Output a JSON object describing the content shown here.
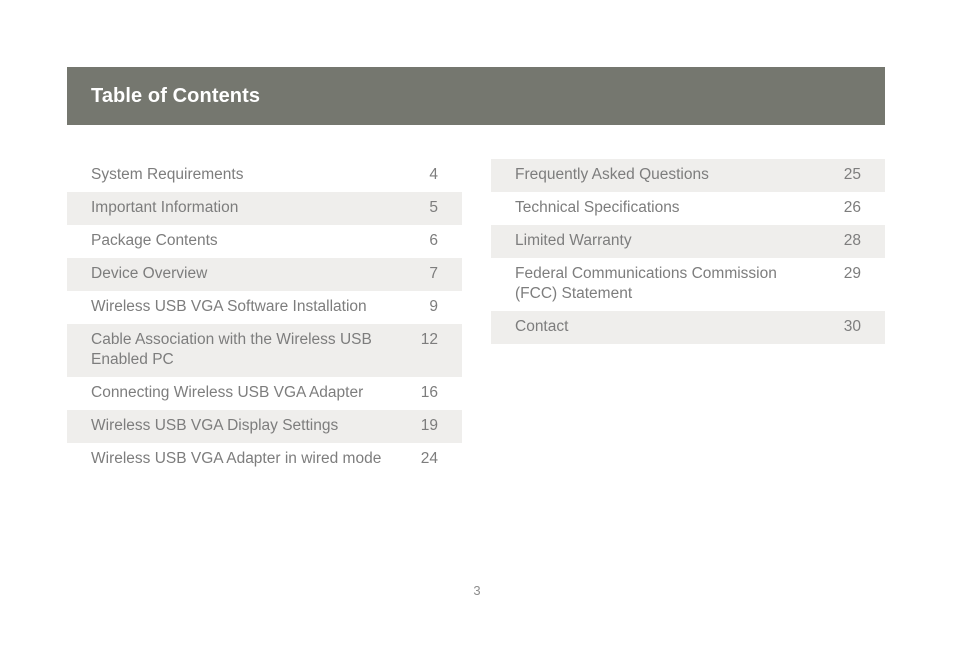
{
  "document": {
    "header": {
      "title": "Table of Contents",
      "background_color": "#75776f",
      "text_color": "#ffffff"
    },
    "styles": {
      "row_shade_color": "#efeeec",
      "row_text_color": "#7d7d7d",
      "page_background": "#ffffff"
    },
    "toc": {
      "left_column": [
        {
          "label": "System Requirements",
          "page": "4",
          "shaded": false
        },
        {
          "label": "Important Information",
          "page": "5",
          "shaded": true
        },
        {
          "label": "Package Contents",
          "page": "6",
          "shaded": false
        },
        {
          "label": "Device Overview",
          "page": "7",
          "shaded": true
        },
        {
          "label": "Wireless USB VGA Software Installation",
          "page": "9",
          "shaded": false
        },
        {
          "label": "Cable Association with the Wireless USB\nEnabled PC",
          "page": "12",
          "shaded": true
        },
        {
          "label": "Connecting Wireless USB VGA Adapter",
          "page": "16",
          "shaded": false
        },
        {
          "label": "Wireless USB VGA Display Settings",
          "page": "19",
          "shaded": true
        },
        {
          "label": "Wireless USB VGA Adapter in wired mode",
          "page": "24",
          "shaded": false
        }
      ],
      "right_column": [
        {
          "label": "Frequently Asked Questions",
          "page": "25",
          "shaded": true
        },
        {
          "label": "Technical Specifications",
          "page": "26",
          "shaded": false
        },
        {
          "label": "Limited Warranty",
          "page": "28",
          "shaded": true
        },
        {
          "label": "Federal Communications Commission\n(FCC) Statement",
          "page": "29",
          "shaded": false
        },
        {
          "label": "Contact",
          "page": "30",
          "shaded": true
        }
      ]
    },
    "footer": {
      "page_number": "3"
    }
  }
}
